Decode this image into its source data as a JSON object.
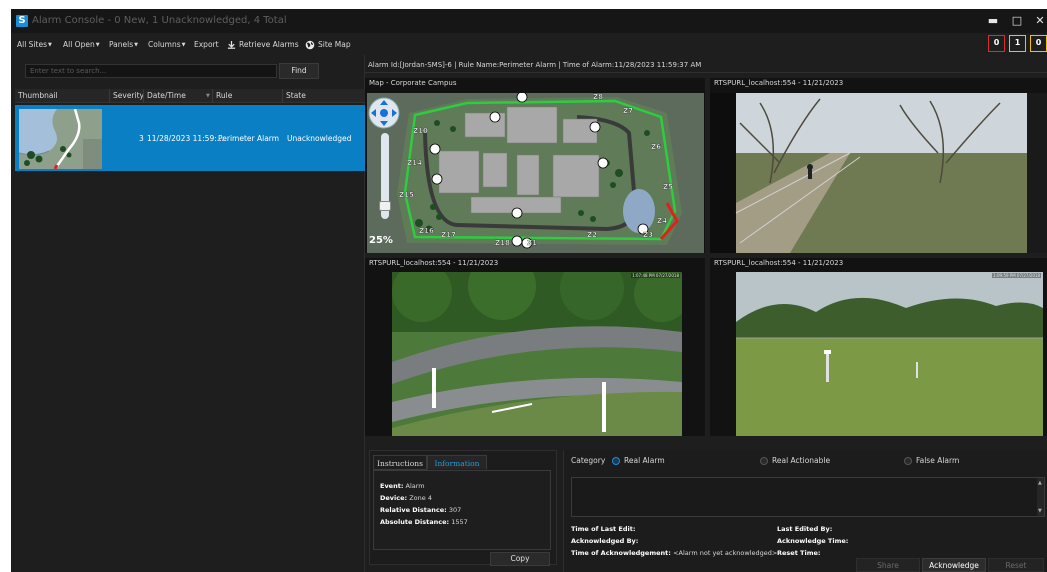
{
  "window": {
    "title": "Alarm Console - 0 New, 1 Unacknowledged, 4 Total",
    "logo": "S",
    "minimize_glyph": "▬",
    "maximize_glyph": "□",
    "close_glyph": "✕"
  },
  "menu": {
    "all_sites": "All Sites",
    "all_open": "All Open",
    "panels": "Panels",
    "columns": "Columns",
    "export": "Export",
    "retrieve_alarms": "Retrieve Alarms",
    "site_map": "Site Map"
  },
  "counters": [
    {
      "value": "0",
      "color": "#d32f2f"
    },
    {
      "value": "1",
      "color": "#f2c200"
    },
    {
      "value": "0",
      "color": "#f2c200"
    }
  ],
  "search": {
    "placeholder": "Enter text to search...",
    "find_label": "Find"
  },
  "alarm_table": {
    "columns": [
      "Thumbnail",
      "Severity",
      "Date/Time",
      "Rule",
      "State"
    ],
    "rows": [
      {
        "severity": "3",
        "datetime": "11/28/2023 11:59:...",
        "rule": "Perimeter Alarm",
        "state": "Unacknowledged"
      }
    ]
  },
  "alarm_header": "Alarm Id:[Jordan-SMS]-6 | Rule Name:Perimeter Alarm | Time of Alarm:11/28/2023 11:59:37 AM",
  "panes": {
    "map_title": "Map - Corporate Campus",
    "zoom_label": "25%",
    "zones": [
      "Z10",
      "Z14",
      "Z15",
      "Z16",
      "Z17",
      "Z18",
      "Z1",
      "Z2",
      "Z3",
      "Z4",
      "Z5",
      "Z6",
      "Z7",
      "Z8"
    ],
    "cam1_title": "RTSPURL_localhost:554 - 11/21/2023",
    "cam2_title": "RTSPURL_localhost:554 - 11/21/2023",
    "cam2_time": "1:07:48 PM 07/27/2018",
    "cam3_title": "RTSPURL_localhost:554 - 11/21/2023",
    "cam3_time": "1:09:59 PM 07/27/2018"
  },
  "tabs": {
    "instructions": "Instructions",
    "information": "Information"
  },
  "information": {
    "event_label": "Event:",
    "event_value": "Alarm",
    "device_label": "Device:",
    "device_value": "Zone 4",
    "rel_label": "Relative Distance:",
    "rel_value": "307",
    "abs_label": "Absolute Distance:",
    "abs_value": "1557"
  },
  "copy_label": "Copy",
  "category": {
    "label": "Category",
    "options": [
      "Real Alarm",
      "Real Actionable",
      "False Alarm"
    ],
    "selected": "Real Alarm"
  },
  "meta": {
    "time_last_edit": "Time of Last Edit:",
    "last_edited_by": "Last Edited By:",
    "acknowledged_by": "Acknowledged By:",
    "acknowledge_time": "Acknowledge Time:",
    "time_of_ack": "Time of Acknowledgement:",
    "time_of_ack_value": "<Alarm not yet acknowledged>",
    "reset_time": "Reset Time:"
  },
  "actions": {
    "share": "Share",
    "acknowledge": "Acknowledge",
    "reset": "Reset"
  },
  "colors": {
    "selection": "#0b7fc4",
    "accent": "#1a8cd8",
    "perimeter": "#2ecc40",
    "alarm": "#e0201b"
  }
}
